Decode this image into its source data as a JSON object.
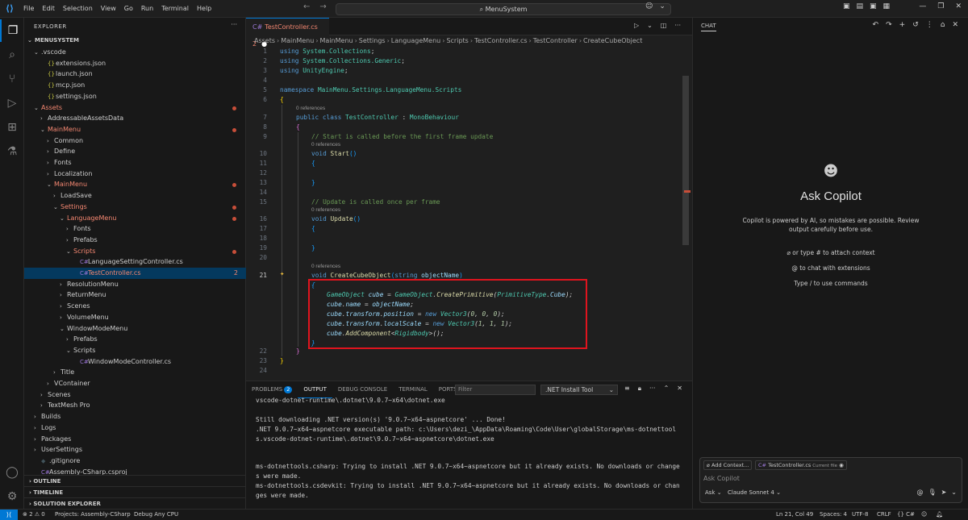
{
  "menu": [
    "File",
    "Edit",
    "Selection",
    "View",
    "Go",
    "Run",
    "Terminal",
    "Help"
  ],
  "command_center": "MenuSystem",
  "sidebar": {
    "title": "EXPLORER",
    "root": "MENUSYSTEM",
    "tree": [
      {
        "label": ".vscode",
        "indent": 1,
        "type": "folder-open"
      },
      {
        "label": "extensions.json",
        "indent": 2,
        "type": "json"
      },
      {
        "label": "launch.json",
        "indent": 2,
        "type": "json"
      },
      {
        "label": "mcp.json",
        "indent": 2,
        "type": "json"
      },
      {
        "label": "settings.json",
        "indent": 2,
        "type": "json"
      },
      {
        "label": "Assets",
        "indent": 1,
        "type": "folder-open",
        "red": true,
        "dot": true
      },
      {
        "label": "AddressableAssetsData",
        "indent": 2,
        "type": "folder"
      },
      {
        "label": "MainMenu",
        "indent": 2,
        "type": "folder-open",
        "red": true,
        "dot": true
      },
      {
        "label": "Common",
        "indent": 3,
        "type": "folder"
      },
      {
        "label": "Define",
        "indent": 3,
        "type": "folder"
      },
      {
        "label": "Fonts",
        "indent": 3,
        "type": "folder"
      },
      {
        "label": "Localization",
        "indent": 3,
        "type": "folder"
      },
      {
        "label": "MainMenu",
        "indent": 3,
        "type": "folder-open",
        "red": true,
        "dot": true
      },
      {
        "label": "LoadSave",
        "indent": 4,
        "type": "folder"
      },
      {
        "label": "Settings",
        "indent": 4,
        "type": "folder-open",
        "red": true,
        "dot": true
      },
      {
        "label": "LanguageMenu",
        "indent": 5,
        "type": "folder-open",
        "red": true,
        "dot": true
      },
      {
        "label": "Fonts",
        "indent": 6,
        "type": "folder"
      },
      {
        "label": "Prefabs",
        "indent": 6,
        "type": "folder"
      },
      {
        "label": "Scripts",
        "indent": 6,
        "type": "folder-open",
        "red": true,
        "dot": true
      },
      {
        "label": "LanguageSettingController.cs",
        "indent": 7,
        "type": "cs"
      },
      {
        "label": "TestController.cs",
        "indent": 7,
        "type": "cs",
        "red": true,
        "selected": true,
        "count": "2"
      },
      {
        "label": "ResolutionMenu",
        "indent": 5,
        "type": "folder"
      },
      {
        "label": "ReturnMenu",
        "indent": 5,
        "type": "folder"
      },
      {
        "label": "Scenes",
        "indent": 5,
        "type": "folder"
      },
      {
        "label": "VolumeMenu",
        "indent": 5,
        "type": "folder"
      },
      {
        "label": "WindowModeMenu",
        "indent": 5,
        "type": "folder-open"
      },
      {
        "label": "Prefabs",
        "indent": 6,
        "type": "folder"
      },
      {
        "label": "Scripts",
        "indent": 6,
        "type": "folder-open"
      },
      {
        "label": "WindowModeController.cs",
        "indent": 7,
        "type": "cs"
      },
      {
        "label": "Title",
        "indent": 4,
        "type": "folder"
      },
      {
        "label": "VContainer",
        "indent": 3,
        "type": "folder"
      },
      {
        "label": "Scenes",
        "indent": 2,
        "type": "folder"
      },
      {
        "label": "TextMesh Pro",
        "indent": 2,
        "type": "folder"
      },
      {
        "label": "Builds",
        "indent": 1,
        "type": "folder"
      },
      {
        "label": "Logs",
        "indent": 1,
        "type": "folder"
      },
      {
        "label": "Packages",
        "indent": 1,
        "type": "folder"
      },
      {
        "label": "UserSettings",
        "indent": 1,
        "type": "folder"
      },
      {
        "label": ".gitignore",
        "indent": 1,
        "type": "git"
      },
      {
        "label": "Assembly-CSharp.csproj",
        "indent": 1,
        "type": "csproj"
      }
    ],
    "sections": [
      "OUTLINE",
      "TIMELINE",
      "SOLUTION EXPLORER"
    ]
  },
  "editor": {
    "tab_label": "TestController.cs",
    "tab_count": "2",
    "breadcrumb": [
      "Assets",
      "MainMenu",
      "MainMenu",
      "Settings",
      "LanguageMenu",
      "Scripts",
      "TestController.cs",
      "TestController",
      "CreateCubeObject"
    ],
    "references_label": "0 references"
  },
  "panel": {
    "tabs": [
      "PROBLEMS",
      "OUTPUT",
      "DEBUG CONSOLE",
      "TERMINAL",
      "PORTS"
    ],
    "problems_badge": "2",
    "filter_placeholder": "Filter",
    "channel": ".NET Install Tool",
    "output_lines": [
      "vscode-dotnet-runtime\\.dotnet\\9.0.7~x64\\dotnet.exe",
      "",
      "Still downloading .NET version(s) '9.0.7~x64~aspnetcore' ... Done!",
      ".NET 9.0.7~x64~aspnetcore executable path: c:\\Users\\dezi_\\AppData\\Roaming\\Code\\User\\globalStorage\\ms-dotnettools.vscode-dotnet-runtime\\.dotnet\\9.0.7~x64~aspnetcore\\dotnet.exe",
      "",
      "ms-dotnettools.csharp: Trying to install .NET 9.0.7~x64~aspnetcore but it already exists. No downloads or changes were made.",
      "ms-dotnettools.csdevkit: Trying to install .NET 9.0.7~x64~aspnetcore but it already exists. No downloads or changes were made."
    ]
  },
  "chat": {
    "title": "CHAT",
    "heading": "Ask Copilot",
    "subtitle": "Copilot is powered by AI, so mistakes are possible. Review output carefully before use.",
    "hint1": "or type # to attach context",
    "hint2": "to chat with extensions",
    "hint3": "Type / to use commands",
    "add_context": "Add Context...",
    "current_file": "TestController.cs",
    "current_file_tag": "Current file",
    "placeholder": "Ask Copilot",
    "mode": "Ask",
    "model": "Claude Sonnet 4"
  },
  "status": {
    "errors": "2",
    "warnings": "0",
    "project": "Projects: Assembly-CSharp",
    "config": "Debug Any CPU",
    "position": "Ln 21, Col 49",
    "spaces": "Spaces: 4",
    "encoding": "UTF-8",
    "eol": "CRLF",
    "language": "C#"
  },
  "colors": {
    "accent": "#0078d4",
    "highlight_box": "#e0141e",
    "modified": "#f48771"
  }
}
